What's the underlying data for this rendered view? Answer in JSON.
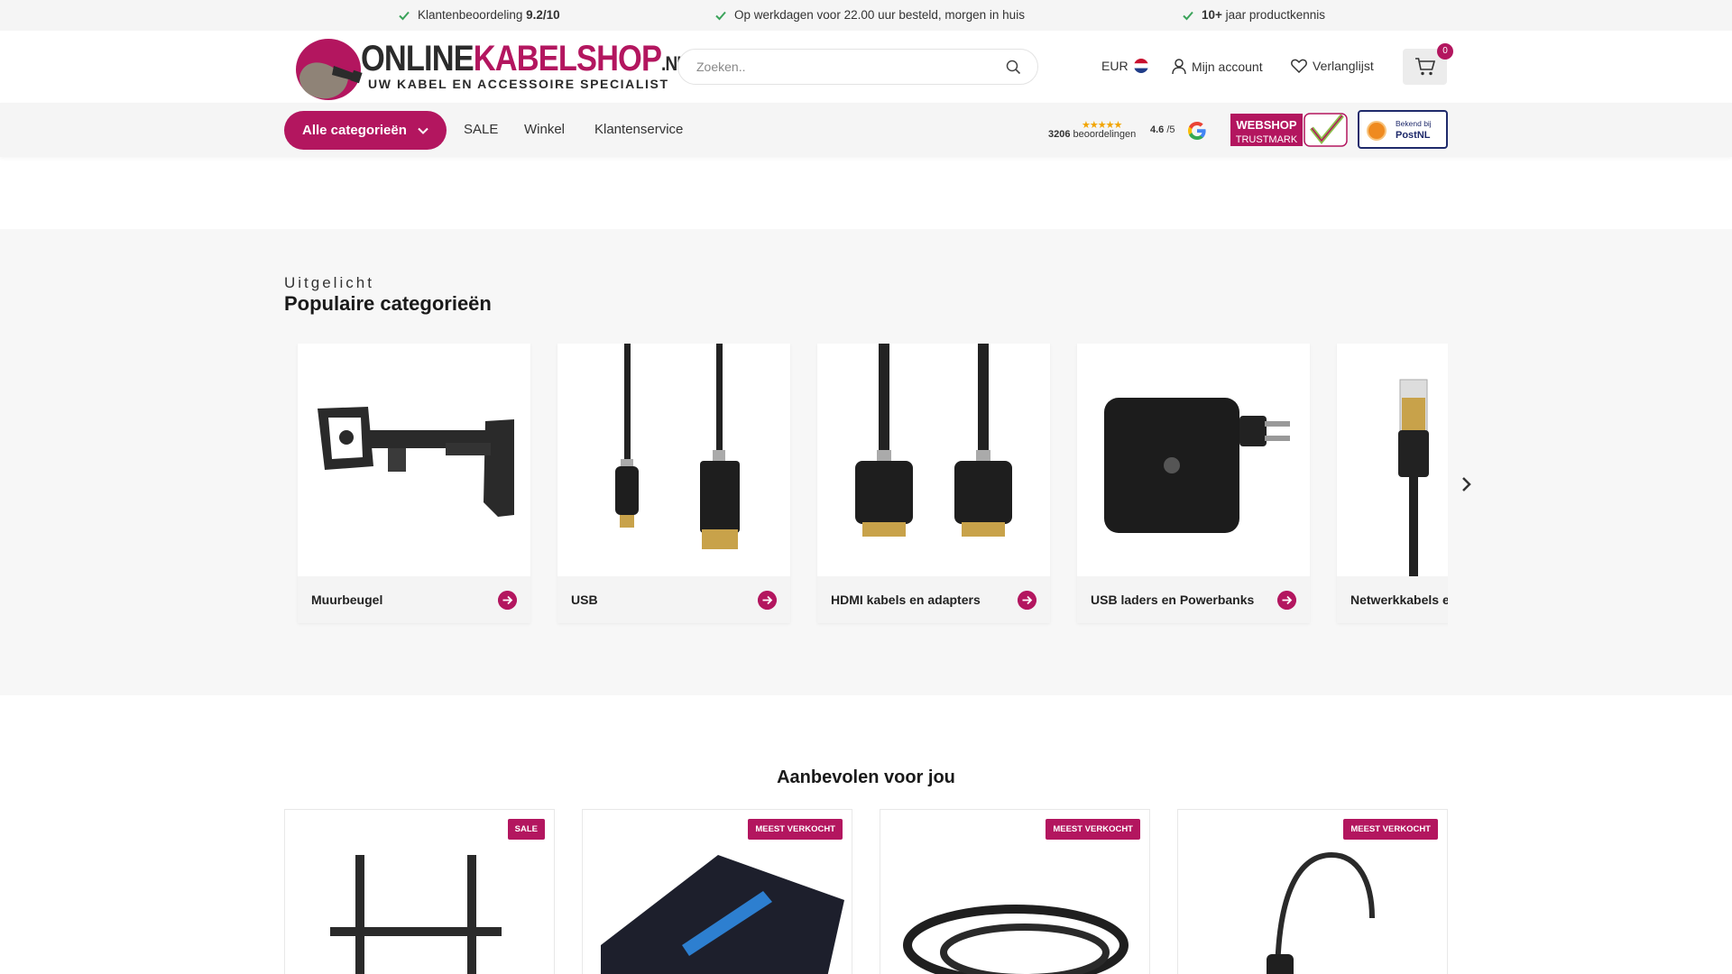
{
  "usp": [
    {
      "text": "Klantenbeoordeling ",
      "bold": "9.2/10",
      "bold_first": false
    },
    {
      "text": "Op werkdagen voor 22.00 uur besteld, morgen in huis",
      "bold": "",
      "bold_first": false
    },
    {
      "text": " jaar productkennis",
      "bold": "10+",
      "bold_first": true
    }
  ],
  "logo": {
    "part1": "ONLINE",
    "part2": "KABELSHOP",
    "part3": ".NL",
    "tagline": "UW KABEL EN ACCESSOIRE SPECIALIST"
  },
  "search": {
    "placeholder": "Zoeken.."
  },
  "header": {
    "currency": "EUR",
    "account": "Mijn account",
    "wishlist": "Verlanglijst",
    "cart_count": "0"
  },
  "nav": {
    "categories_button": "Alle categorieën",
    "links": [
      "SALE",
      "Winkel",
      "Klantenservice"
    ]
  },
  "rating": {
    "stars": "★★★★★",
    "count": "3206",
    "count_suffix": " beoordelingen",
    "score": "4.6",
    "score_suffix": " /5"
  },
  "trustmark": {
    "line1": "WEBSHOP",
    "line2": "TRUSTMARK"
  },
  "postnl": {
    "line1": "Bekend bij",
    "line2": "PostNL"
  },
  "featured": {
    "eyebrow": "Uitgelicht",
    "title": "Populaire categorieën",
    "categories": [
      {
        "label": "Muurbeugel",
        "icon": "wall-mount-image"
      },
      {
        "label": "USB",
        "icon": "usb-cable-image"
      },
      {
        "label": "HDMI kabels en adapters",
        "icon": "hdmi-cable-image"
      },
      {
        "label": "USB laders en Powerbanks",
        "icon": "usb-charger-image"
      },
      {
        "label": "Netwerkkabels en",
        "icon": "network-cable-image"
      }
    ]
  },
  "recommended": {
    "title": "Aanbevolen voor jou",
    "products": [
      {
        "badge": "SALE",
        "icon": "tv-mount-image"
      },
      {
        "badge": "MEEST VERKOCHT",
        "icon": "scart-hdmi-converter-image"
      },
      {
        "badge": "MEEST VERKOCHT",
        "icon": "car-charger-cable-image"
      },
      {
        "badge": "MEEST VERKOCHT",
        "icon": "headset-image"
      }
    ]
  },
  "colors": {
    "brand": "#b3165f",
    "check": "#3aa35a",
    "text": "#222222"
  }
}
